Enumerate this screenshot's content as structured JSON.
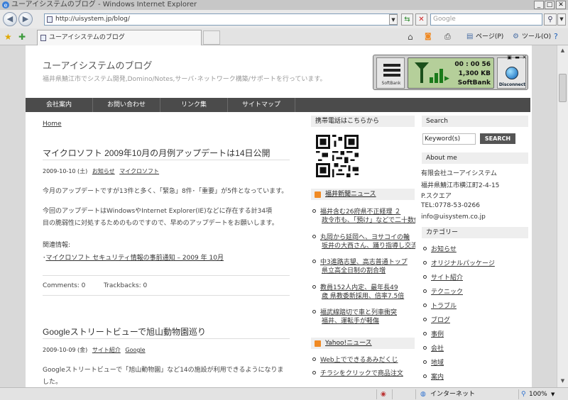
{
  "window": {
    "title": "ユーアイシステムのブログ - Windows Internet Explorer"
  },
  "browser": {
    "address": "http://uisystem.jp/blog/",
    "search_placeholder": "Google",
    "tab_title": "ユーアイシステムのブログ",
    "page_menu": "ページ(P)",
    "tools_menu": "ツール(O)",
    "status_zone": "インターネット",
    "zoom": "100%"
  },
  "site": {
    "title": "ユーアイシステムのブログ",
    "description": "福井県鯖江市でシステム開発,Domino/Notes,サーバ･ネットワーク構築/サポートを行っています。"
  },
  "widget": {
    "timer": "00 : 00 56",
    "data": "1,300 KB",
    "brand": "SoftBank",
    "logo_text": "SoftBank",
    "disconnect": "Disconnect"
  },
  "nav": [
    "会社案内",
    "お問い合わせ",
    "リンク集",
    "サイトマップ"
  ],
  "breadcrumb": "Home",
  "posts": [
    {
      "title": "マイクロソフト 2009年10月の月例アップデートは14日公開",
      "date": "2009-10-10 (土)",
      "categories": [
        "お知らせ",
        "マイクロソフト"
      ],
      "para1": "今月のアップデートですが13件と多く、「緊急」8件･「重要」が5件となっています。",
      "para2_line1": "今回のアップデートはWindowsやInternet Explorer(IE)などに存在する計34項",
      "para2_line2": "目の脆弱性に対処するためのものですので、早めのアップデートをお願いします。",
      "related_label": "関連情報:",
      "related_prefix": "･",
      "related_link": "マイクロソフト セキュリティ情報の事前通知 – 2009 年 10月",
      "comments": "Comments: 0",
      "trackbacks": "Trackbacks: 0"
    },
    {
      "title": "Googleストリートビューで旭山動物園巡り",
      "date": "2009-10-09 (金)",
      "categories": [
        "サイト紹介",
        "Google"
      ],
      "para1": "Googleストリートビューで「旭山動物園」など14の施設が利用できるようになりま",
      "para1_line2": "した。"
    }
  ],
  "sidebar1": {
    "mobile_head": "携帯電話はこちらから",
    "fukui_head": "福井新聞ニュース",
    "fukui_items": [
      [
        "福井含む26府県不正経理 ２",
        "政令市も、「預け」などで二十数億"
      ],
      [
        "丸岡から延岡へ、ヨサコイの輪",
        "坂井の大西さん、踊り指導し交流"
      ],
      [
        "中3進路志望、高志普通トップ",
        "県立高全日制の割合増"
      ],
      [
        "教員152人内定、最年長49",
        "歳 県教委新採用、倍率7.5倍"
      ],
      [
        "福武線踏切で車と列車衝突",
        "福井、運転手が軽傷"
      ]
    ],
    "yahoo_head": "Yahoo!ニュース",
    "yahoo_items": [
      "Web上でできるあみだくじ",
      "チラシをクリックで商品注文"
    ]
  },
  "sidebar2": {
    "search_head": "Search",
    "keyword": "Keyword(s)",
    "search_button": "SEARCH",
    "about_head": "About me",
    "about_lines": [
      "有限会社ユーアイシステム",
      "福井県鯖江市横江町2-4-15",
      "P.スクエア",
      "TEL:0778-53-0266",
      "info@uisystem.co.jp"
    ],
    "category_head": "カテゴリー",
    "categories": [
      "お知らせ",
      "オリジナルパッケージ",
      "サイト紹介",
      "テクニック",
      "トラブル",
      "ブログ",
      "事例",
      "会社",
      "地域",
      "案内"
    ]
  },
  "colors": {
    "nav_bg": "#4b4b4b",
    "rss": "#f08a24",
    "lcd": "#b5cf9a"
  }
}
